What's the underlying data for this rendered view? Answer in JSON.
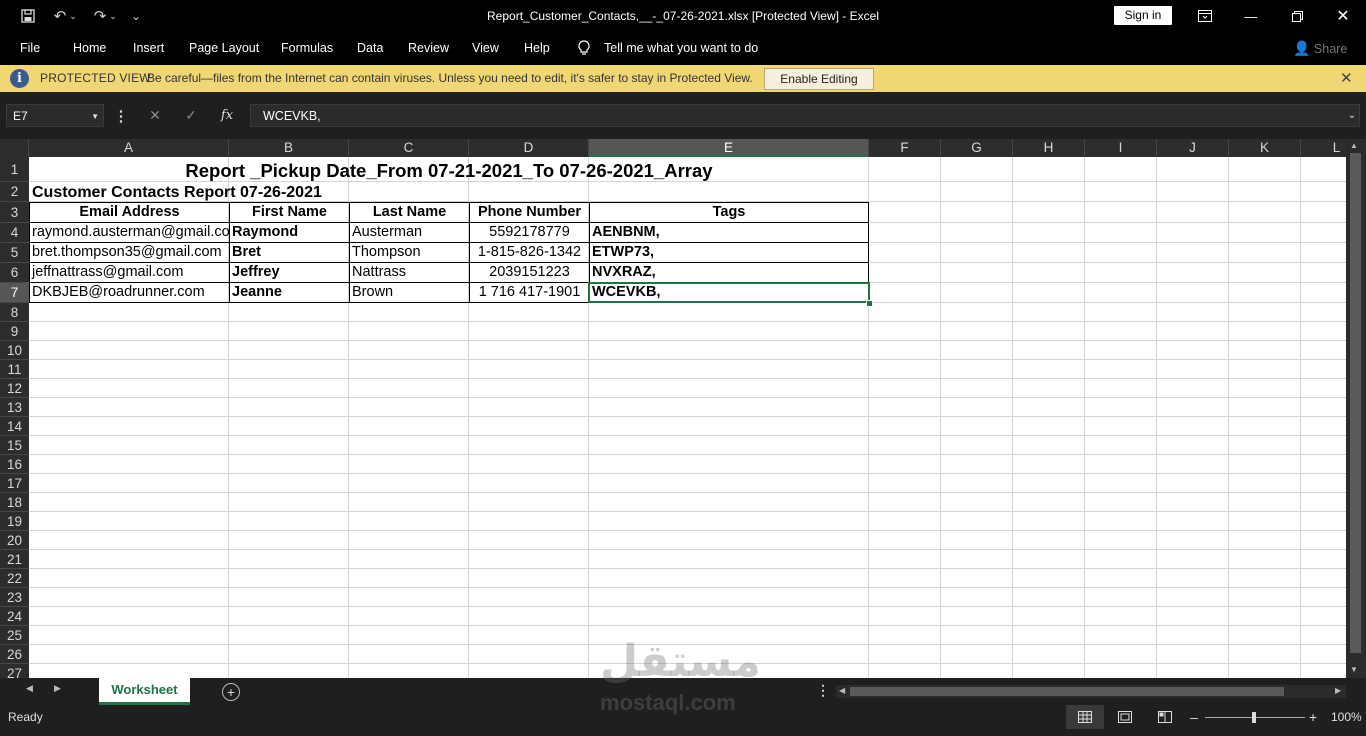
{
  "window": {
    "title": "Report_Customer_Contacts,__-_07-26-2021.xlsx  [Protected View]  -  Excel",
    "sign_in": "Sign in"
  },
  "menu": [
    "File",
    "Home",
    "Insert",
    "Page Layout",
    "Formulas",
    "Data",
    "Review",
    "View",
    "Help"
  ],
  "tell_me": "Tell me what you want to do",
  "share": "Share",
  "protected_view": {
    "title": "PROTECTED VIEW",
    "message": "Be careful—files from the Internet can contain viruses. Unless you need to edit, it's safer to stay in Protected View.",
    "button": "Enable Editing"
  },
  "name_box": "E7",
  "formula_content": "WCEVKB,",
  "fx_label": "fx",
  "columns": [
    "A",
    "B",
    "C",
    "D",
    "E",
    "F",
    "G",
    "H",
    "I",
    "J",
    "K",
    "L"
  ],
  "rows": [
    "1",
    "2",
    "3",
    "4",
    "5",
    "6",
    "7",
    "8",
    "9",
    "10",
    "11",
    "12",
    "13",
    "14",
    "15",
    "16",
    "17",
    "18",
    "19",
    "20",
    "21",
    "22",
    "23",
    "24",
    "25",
    "26",
    "27"
  ],
  "sheet": {
    "report_title": "Report _Pickup Date_From 07-21-2021_To 07-26-2021_Array",
    "subtitle": "Customer Contacts Report 07-26-2021",
    "headers": [
      "Email Address",
      "First Name",
      "Last Name",
      "Phone Number",
      "Tags"
    ],
    "records": [
      [
        "raymond.austerman@gmail.com",
        "Raymond",
        "Austerman",
        "5592178779",
        "AENBNM,"
      ],
      [
        "bret.thompson35@gmail.com",
        "Bret",
        "Thompson",
        "1-815-826-1342",
        "ETWP73,"
      ],
      [
        "jeffnattrass@gmail.com",
        "Jeffrey",
        "Nattrass",
        "2039151223",
        "NVXRAZ,"
      ],
      [
        "DKBJEB@roadrunner.com",
        "Jeanne",
        "Brown",
        "1 716 417-1901",
        "WCEVKB,"
      ]
    ]
  },
  "sheet_tab": "Worksheet",
  "status": {
    "ready": "Ready",
    "zoom": "100%"
  },
  "watermark": {
    "arabic": "مستقل",
    "latin": "mostaql.com"
  },
  "colors": {
    "accent": "#217346",
    "protected_bar": "#f1d676",
    "chrome": "#000000"
  }
}
